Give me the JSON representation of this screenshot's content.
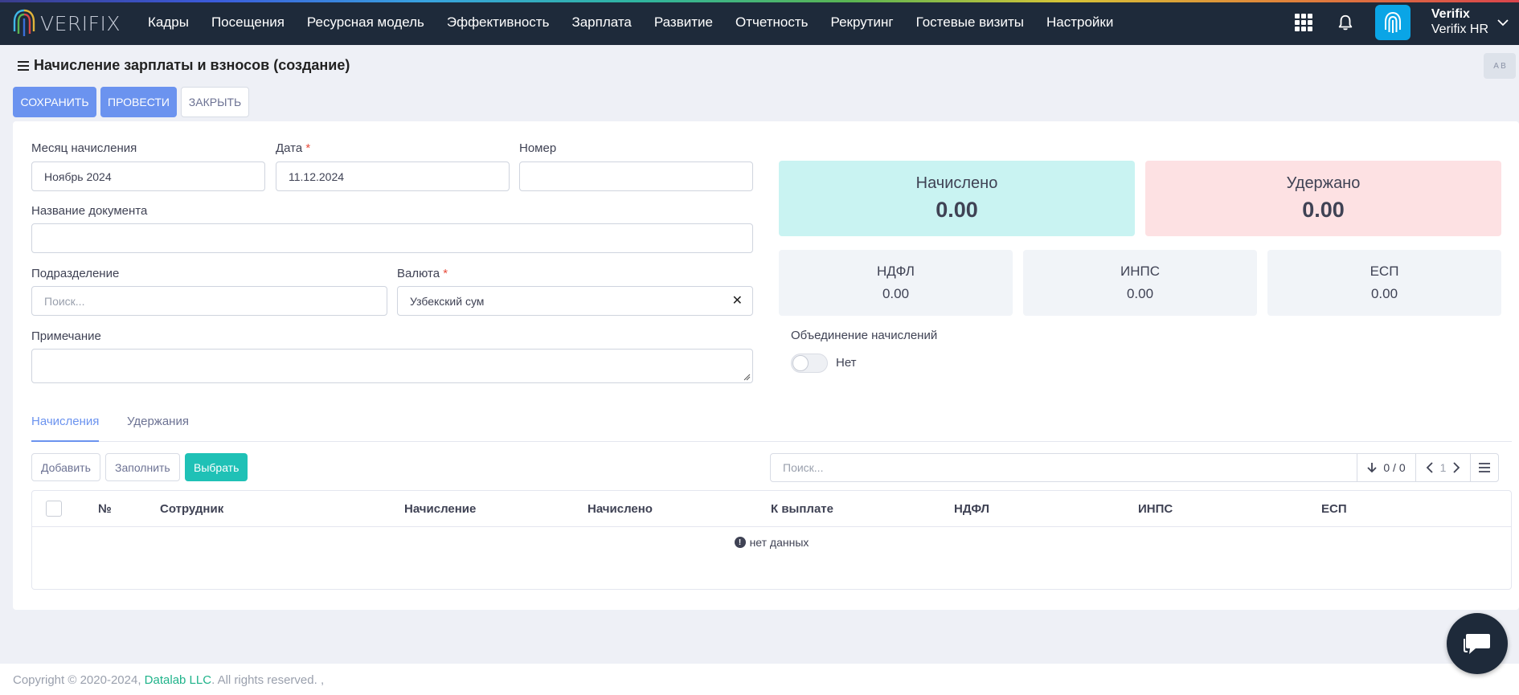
{
  "brand": {
    "logo_text": "VERIFIX"
  },
  "nav": [
    "Кадры",
    "Посещения",
    "Ресурсная модель",
    "Эффективность",
    "Зарплата",
    "Развитие",
    "Отчетность",
    "Рекрутинг",
    "Гостевые визиты",
    "Настройки"
  ],
  "user": {
    "name": "Verifix",
    "company": "Verifix HR"
  },
  "page": {
    "title": "Начисление зарплаты и взносов (создание)"
  },
  "toolbar": {
    "save": "СОХРАНИТЬ",
    "post": "ПРОВЕСТИ",
    "close": "ЗАКРЫТЬ"
  },
  "form": {
    "month_label": "Месяц начисления",
    "month_value": "Ноябрь 2024",
    "date_label": "Дата",
    "date_value": "11.12.2024",
    "number_label": "Номер",
    "number_value": "",
    "docname_label": "Название документа",
    "docname_value": "",
    "division_label": "Подразделение",
    "division_placeholder": "Поиск...",
    "currency_label": "Валюта",
    "currency_value": "Узбекский сум",
    "note_label": "Примечание",
    "note_value": "",
    "required_mark": "*"
  },
  "summary": {
    "accrued_label": "Начислено",
    "accrued_value": "0.00",
    "withheld_label": "Удержано",
    "withheld_value": "0.00",
    "ndfl_label": "НДФЛ",
    "ndfl_value": "0.00",
    "inps_label": "ИНПС",
    "inps_value": "0.00",
    "esp_label": "ЕСП",
    "esp_value": "0.00"
  },
  "merge": {
    "label": "Объединение начислений",
    "state_text": "Нет"
  },
  "tabs": [
    "Начисления",
    "Удержания"
  ],
  "table_toolbar": {
    "add": "Добавить",
    "fill": "Заполнить",
    "select": "Выбрать",
    "search_placeholder": "Поиск...",
    "count": "0 / 0",
    "page": "1"
  },
  "table": {
    "columns": [
      "№",
      "Сотрудник",
      "Начисление",
      "Начислено",
      "К выплате",
      "НДФЛ",
      "ИНПС",
      "ЕСП"
    ],
    "empty_text": "нет данных"
  },
  "footer": {
    "prefix": "Copyright © 2020-2024,",
    "company": "Datalab LLC",
    "suffix": ". All rights reserved. ,"
  },
  "colors": {
    "topbar": "#1e2a3a",
    "primary": "#6b93ef",
    "teal": "#1fc1b6",
    "accrued_bg": "#c9f3f2",
    "withheld_bg": "#fde1e3",
    "tax_bg": "#f1f4f8"
  },
  "lang_button": "A B"
}
